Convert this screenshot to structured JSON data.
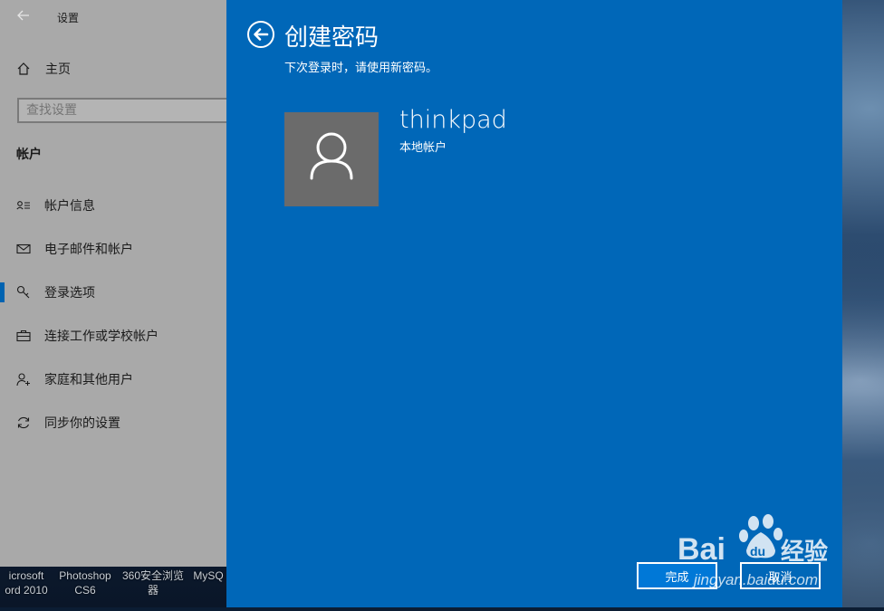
{
  "desktop": {
    "taskbar_items": [
      {
        "line1": "icrosoft",
        "line2": "ord 2010"
      },
      {
        "line1": "Photoshop",
        "line2": "CS6"
      },
      {
        "line1": "360安全浏览",
        "line2": "器"
      },
      {
        "line1": "MySQ",
        "line2": ""
      }
    ]
  },
  "settings": {
    "title": "设置",
    "home_label": "主页",
    "search_placeholder": "查找设置",
    "section_title": "帐户",
    "nav_items": [
      {
        "label": "帐户信息",
        "icon": "account-info-icon"
      },
      {
        "label": "电子邮件和帐户",
        "icon": "mail-icon"
      },
      {
        "label": "登录选项",
        "icon": "key-icon"
      },
      {
        "label": "连接工作或学校帐户",
        "icon": "briefcase-icon"
      },
      {
        "label": "家庭和其他用户",
        "icon": "add-person-icon"
      },
      {
        "label": "同步你的设置",
        "icon": "sync-icon"
      }
    ],
    "active_index": 2
  },
  "dialog": {
    "title": "创建密码",
    "subtitle": "下次登录时，请使用新密码。",
    "user": {
      "name": "thinkpad",
      "type": "本地帐户"
    },
    "finish_label": "完成",
    "cancel_label": "取消",
    "accent_color": "#0067b8"
  },
  "watermark": {
    "brand": "Bai",
    "brand_suffix": "du",
    "cn_text": "经验",
    "url": "jingyan.baidu.com"
  }
}
